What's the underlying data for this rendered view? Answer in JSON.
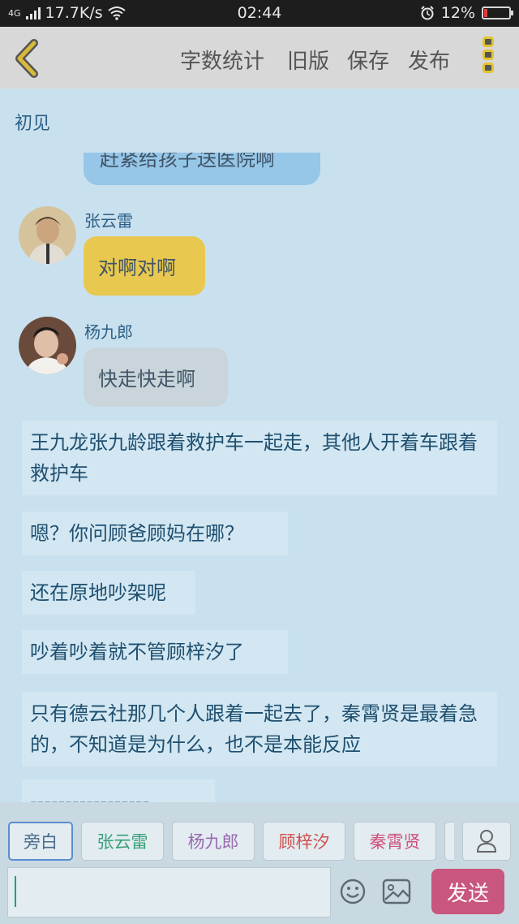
{
  "status": {
    "net": "4G",
    "speed": "17.7K/s",
    "time": "02:44",
    "battery": "12%",
    "battery_level": 0.12,
    "icons": [
      "signal-icon",
      "wifi-icon",
      "alarm-icon",
      "battery-icon"
    ]
  },
  "header": {
    "back_icon": "chevron-left-icon",
    "buttons": [
      "字数统计",
      "旧版",
      "保存",
      "发布"
    ],
    "more_icon": "more-vertical-icon"
  },
  "title": "初见",
  "messages": {
    "cut_bubble": "赶紧给孩子送医院啊",
    "m1": {
      "name": "张云雷",
      "text": "对啊对啊",
      "color": "#e8c84e"
    },
    "m2": {
      "name": "杨九郎",
      "text": "快走快走啊",
      "color": "#c9d5db"
    }
  },
  "narration": [
    "王九龙张九龄跟着救护车一起走，其他人开着车跟着救护车",
    "嗯？你问顾爸顾妈在哪？",
    "还在原地吵架呢",
    "吵着吵着就不管顾梓汐了",
    "只有德云社那几个人跟着一起去了，秦霄贤是最着急的，不知道是为什么，也不是本能反应",
    "-----------------"
  ],
  "characters": [
    {
      "label": "旁白",
      "color": "#4a6b8a"
    },
    {
      "label": "张云雷",
      "color": "#3aa079"
    },
    {
      "label": "杨九郎",
      "color": "#9a6ab0"
    },
    {
      "label": "顾梓汐",
      "color": "#d0504f"
    },
    {
      "label": "秦霄贤",
      "color": "#d0507a"
    }
  ],
  "input": {
    "placeholder": "",
    "send_label": "发送",
    "icons": [
      "emoji-icon",
      "image-icon",
      "person-icon"
    ]
  }
}
